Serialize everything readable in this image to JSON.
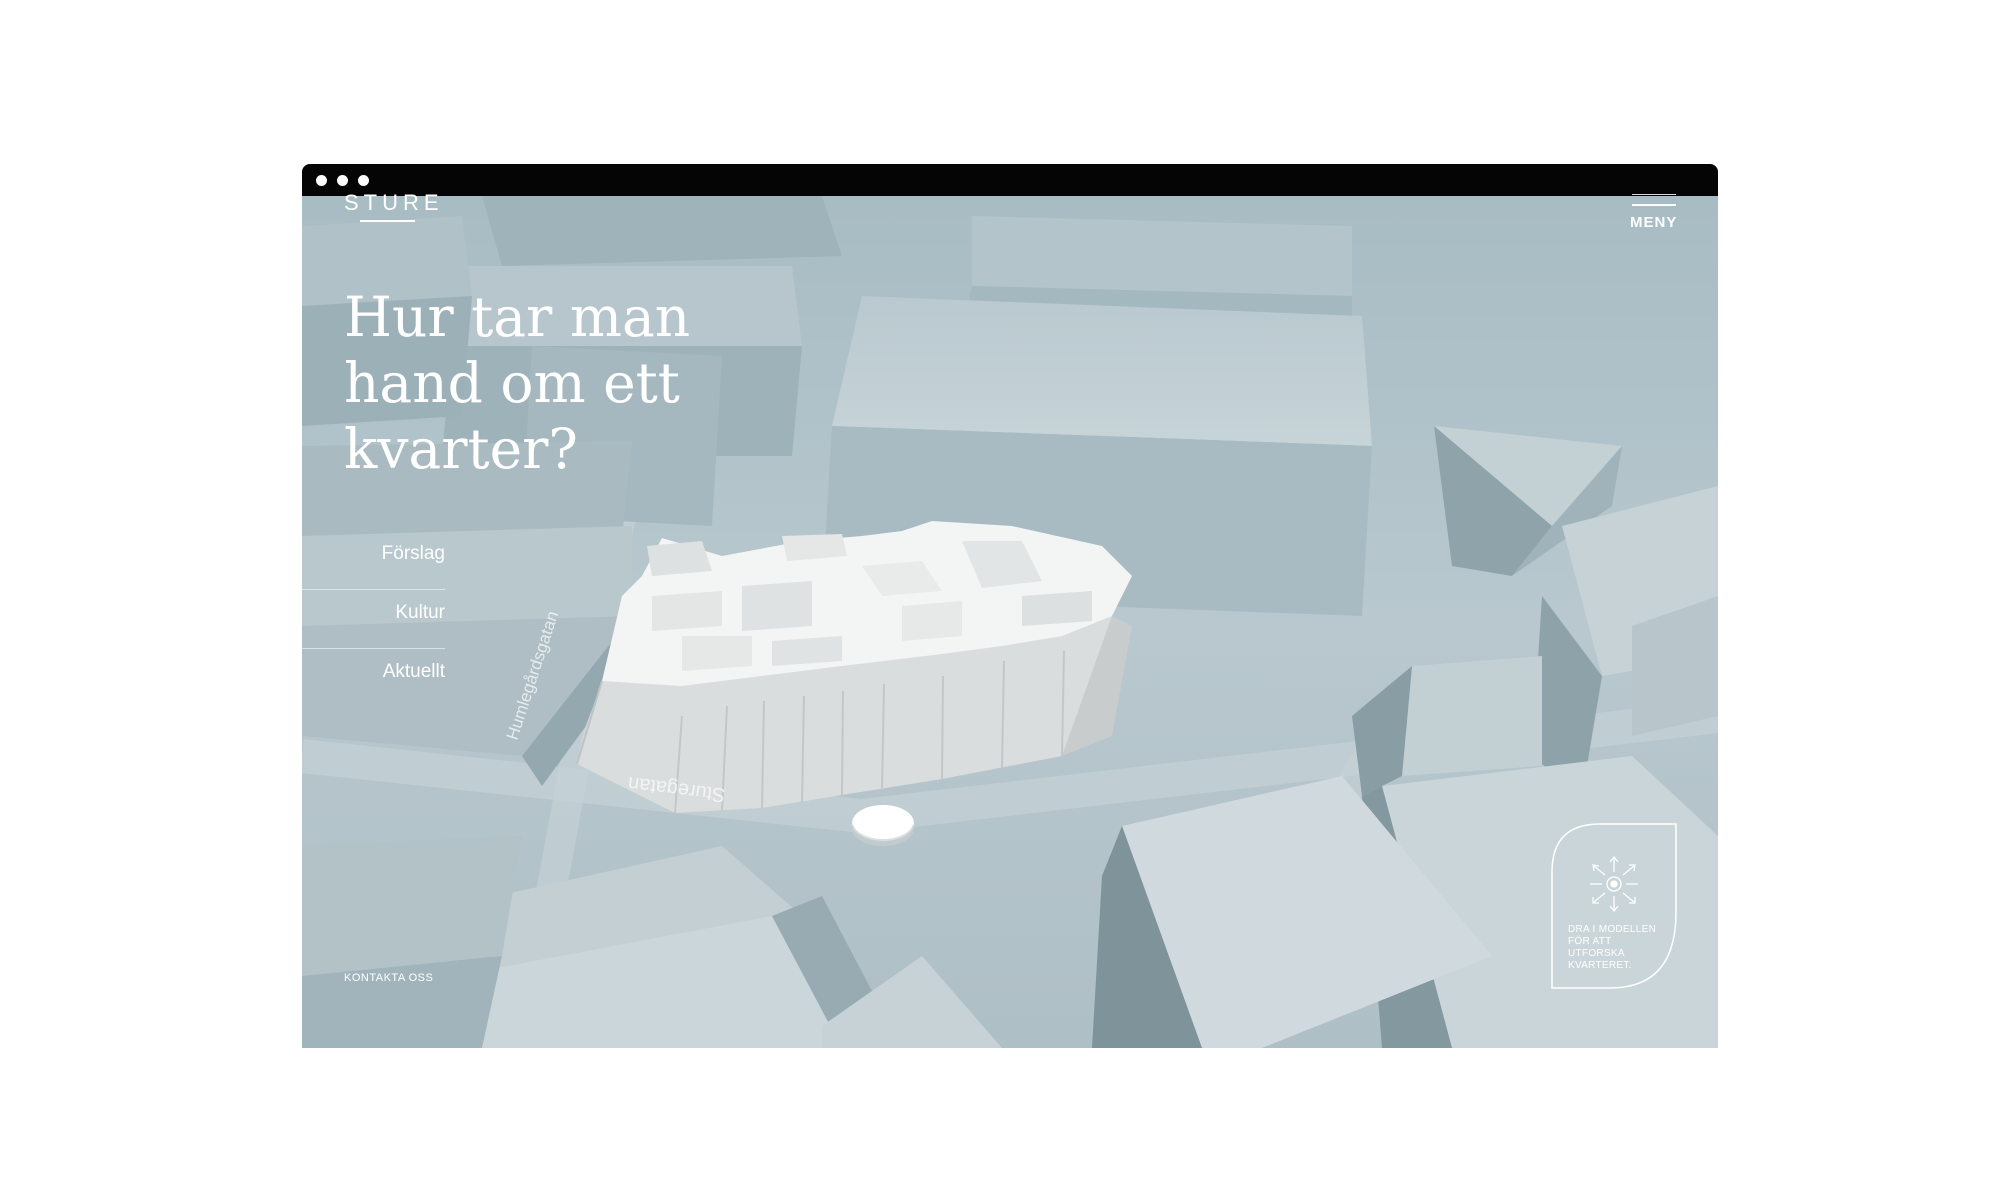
{
  "browser": {
    "dots": 3
  },
  "header": {
    "logo": "STURE",
    "menu_label": "MENY"
  },
  "hero": {
    "headline": "Hur tar man hand om ett kvarter?"
  },
  "nav": {
    "items": [
      {
        "label": "Förslag"
      },
      {
        "label": "Kultur"
      },
      {
        "label": "Aktuellt"
      }
    ]
  },
  "footer": {
    "contact": "KONTAKTA OSS"
  },
  "map": {
    "streets": {
      "a": "Humlegårdsgatan",
      "b": "Sturegatan"
    }
  },
  "hint": {
    "text": "DRA I MODELLEN FÖR ATT UTFORSKA KVARTERET."
  },
  "colors": {
    "background": "#a9bcc4",
    "chrome": "#050505",
    "text": "#ffffff",
    "model": "#eceeee"
  }
}
